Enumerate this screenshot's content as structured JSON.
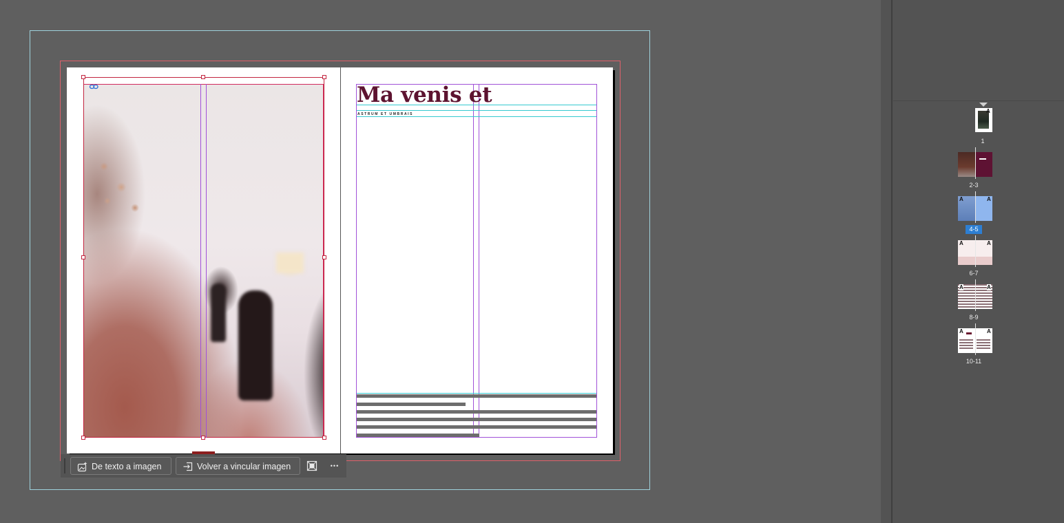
{
  "document": {
    "headline": "Ma venis et",
    "subhead": "ASTRUM ET UMBRAIS"
  },
  "context_toolbar": {
    "text_to_image_label": "De texto a imagen",
    "relink_label": "Volver a vincular imagen",
    "frame_fit_icon": "frame-fit-icon",
    "more_label": "•••"
  },
  "pages_panel": {
    "master_marker": "A",
    "pages": [
      {
        "label": "1",
        "selected": false
      },
      {
        "label": "2-3",
        "selected": false
      },
      {
        "label": "4-5",
        "selected": true
      },
      {
        "label": "6-7",
        "selected": false
      },
      {
        "label": "8-9",
        "selected": false
      },
      {
        "label": "10-11",
        "selected": false
      }
    ]
  },
  "colors": {
    "headline": "#5d1330",
    "selection": "#d1285c",
    "margin_guide": "#a050d8",
    "baseline_guide": "#34c9d0",
    "bleed_guide": "#e0606a",
    "slug_guide": "#9fd2dc",
    "selected_page": "#2d7fd3"
  }
}
